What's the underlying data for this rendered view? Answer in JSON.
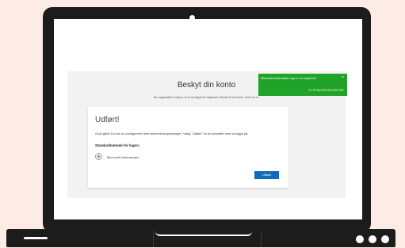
{
  "page": {
    "title": "Beskyt din konto",
    "subtitle": "Din organisation kræver, at du konfigurerer følgende metoder til at bevise, hvem du er."
  },
  "card": {
    "heading": "Udført!",
    "text": "Godt gået! Du har nu konfigureret dine sikkerhedsoplysninger. Vælg \"Udført\" for at fortsætte med at logge på.",
    "default_method_label": "Standardmetode for logon:",
    "method_name": "Microsoft Authenticator",
    "done_button": "Udført"
  },
  "toast": {
    "message": "Microsoft Authenticator app er nu registreret",
    "close_symbol": "×",
    "time": "Fri, 29 Sep 2023 06:02:38 GMT"
  },
  "colors": {
    "background": "#fdece6",
    "device": "#1c1c1c",
    "toast": "#21a229",
    "button": "#0f6cbd"
  }
}
